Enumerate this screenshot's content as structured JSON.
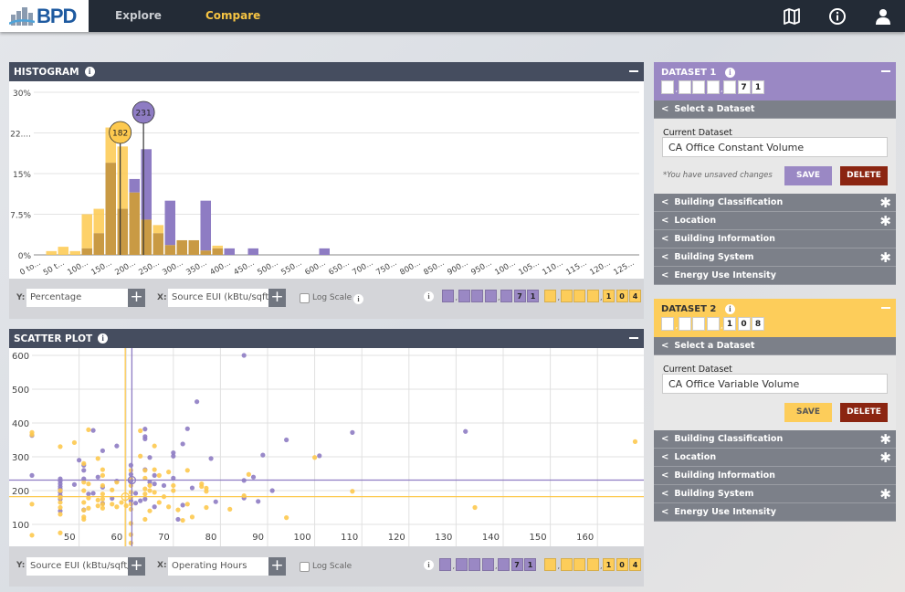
{
  "nav": {
    "logo_text": "BPD",
    "links": [
      {
        "label": "Explore",
        "active": false
      },
      {
        "label": "Compare",
        "active": true
      }
    ],
    "icons": [
      "map-icon",
      "info-icon",
      "user-icon"
    ],
    "colors": {
      "bg": "#232b36",
      "active": "#f6c443",
      "inactive": "#c9ccd1"
    }
  },
  "colors": {
    "dataset1": "#8e7cc3",
    "dataset2": "#fdc94f",
    "overlap": "#c99a44",
    "delete": "#8b2511"
  },
  "histogram": {
    "title": "HISTOGRAM",
    "y_label": "Y:",
    "y_value": "Percentage",
    "x_label": "X:",
    "x_value": "Source EUI (kBtu/sqft/y",
    "log_scale_label": "Log Scale",
    "log_scale_checked": false,
    "counter1": "71",
    "counter2": "104"
  },
  "scatter": {
    "title": "SCATTER PLOT",
    "y_label": "Y:",
    "y_value": "Source EUI (kBtu/sqft/y",
    "x_label": "X:",
    "x_value": "Operating Hours",
    "log_scale_label": "Log Scale",
    "log_scale_checked": false,
    "counter1": "71",
    "counter2": "104"
  },
  "datasets": [
    {
      "title": "DATASET 1",
      "count": "71",
      "color": "#9a88c4",
      "select_label": "Select a Dataset",
      "current_label": "Current Dataset",
      "current_value": "CA Office Constant Volume",
      "unsaved": "*You have unsaved changes",
      "save": "SAVE",
      "delete": "DELETE",
      "save_color": "#9a88c4",
      "sections": [
        {
          "label": "Building Classification",
          "filtered": true
        },
        {
          "label": "Location",
          "filtered": true
        },
        {
          "label": "Building Information",
          "filtered": false
        },
        {
          "label": "Building System",
          "filtered": true
        },
        {
          "label": "Energy Use Intensity",
          "filtered": false
        }
      ]
    },
    {
      "title": "DATASET 2",
      "count": "108",
      "color": "#fdcd5a",
      "select_label": "Select a Dataset",
      "current_label": "Current Dataset",
      "current_value": "CA Office Variable Volume",
      "unsaved": "",
      "save": "SAVE",
      "delete": "DELETE",
      "save_color": "#fdcd5a",
      "sections": [
        {
          "label": "Building Classification",
          "filtered": true
        },
        {
          "label": "Location",
          "filtered": true
        },
        {
          "label": "Building Information",
          "filtered": false
        },
        {
          "label": "Building System",
          "filtered": true
        },
        {
          "label": "Energy Use Intensity",
          "filtered": false
        }
      ]
    }
  ],
  "chart_data": [
    {
      "type": "bar",
      "title": "HISTOGRAM",
      "bin_width": 25,
      "xlim": [
        0,
        1275
      ],
      "ylim": [
        0,
        30
      ],
      "y_ticks": [
        "0%",
        "7.5%",
        "15%",
        "22....",
        "30%"
      ],
      "y_tick_values": [
        0,
        7.5,
        15,
        22.5,
        30
      ],
      "x_tick_labels": [
        "0 to...",
        "50 t...",
        "100...",
        "150...",
        "200...",
        "250...",
        "300...",
        "350...",
        "400...",
        "450...",
        "500...",
        "550...",
        "600...",
        "650...",
        "700...",
        "750...",
        "800...",
        "850...",
        "900...",
        "950...",
        "100...",
        "105...",
        "110...",
        "115...",
        "120...",
        "125..."
      ],
      "x_tick_values": [
        0,
        50,
        100,
        150,
        200,
        250,
        300,
        350,
        400,
        450,
        500,
        550,
        600,
        650,
        700,
        750,
        800,
        850,
        900,
        950,
        1000,
        1050,
        1100,
        1150,
        1200,
        1250
      ],
      "series": [
        {
          "color": "#8e7cc3",
          "mean": 231,
          "values": [
            0,
            0,
            0,
            0,
            1.2,
            4,
            17,
            8.5,
            14,
            19.5,
            4,
            10,
            2.7,
            2.7,
            10,
            1.2,
            1.2,
            0,
            1.2,
            0,
            0,
            0,
            0,
            0,
            1.2
          ]
        },
        {
          "color": "#fdc94f",
          "mean": 182,
          "values": [
            0,
            0.7,
            1.5,
            0.7,
            7.5,
            8.5,
            23.5,
            20,
            11.5,
            6.5,
            5.5,
            1.8,
            2.7,
            2.7,
            0.8,
            1.7,
            0,
            0,
            0,
            0,
            0,
            0,
            0,
            0,
            0
          ]
        }
      ],
      "grid": "horizontal"
    },
    {
      "type": "scatter",
      "title": "SCATTER PLOT",
      "xlim": [
        40,
        170
      ],
      "ylim": [
        38,
        600
      ],
      "x_ticks": [
        50,
        60,
        70,
        80,
        90,
        100,
        110,
        120,
        130,
        140,
        150,
        160
      ],
      "y_ticks": [
        100,
        200,
        300,
        400,
        500,
        600
      ],
      "grid": "both",
      "series": [
        {
          "color": "#8e7cc3",
          "mean_x": 61.2,
          "mean_y": 231,
          "points": [
            [
              40,
              363
            ],
            [
              40,
              245
            ],
            [
              46,
              235
            ],
            [
              46,
              228
            ],
            [
              46,
              220
            ],
            [
              46,
              212
            ],
            [
              46,
              205
            ],
            [
              46,
              195
            ],
            [
              46,
              185
            ],
            [
              46,
              175
            ],
            [
              46,
              140
            ],
            [
              49,
              218
            ],
            [
              50,
              290
            ],
            [
              51,
              275
            ],
            [
              51,
              260
            ],
            [
              51,
              235
            ],
            [
              51,
              143
            ],
            [
              52,
              190
            ],
            [
              53,
              192
            ],
            [
              53,
              378
            ],
            [
              54,
              240
            ],
            [
              55,
              318
            ],
            [
              55,
              210
            ],
            [
              55,
              162
            ],
            [
              57,
              177
            ],
            [
              58,
              332
            ],
            [
              58,
              228
            ],
            [
              61,
              275
            ],
            [
              61,
              248
            ],
            [
              61,
              228
            ],
            [
              61,
              170
            ],
            [
              62,
              192
            ],
            [
              62,
              163
            ],
            [
              63,
              170
            ],
            [
              64,
              382
            ],
            [
              64,
              360
            ],
            [
              64,
              353
            ],
            [
              64,
              262
            ],
            [
              64,
              175
            ],
            [
              65,
              225
            ],
            [
              65,
              298
            ],
            [
              66,
              245
            ],
            [
              66,
              220
            ],
            [
              66,
              152
            ],
            [
              68,
              215
            ],
            [
              70,
              312
            ],
            [
              70,
              302
            ],
            [
              70,
              237
            ],
            [
              71,
              115
            ],
            [
              72,
              338
            ],
            [
              72,
              157
            ],
            [
              73,
              383
            ],
            [
              74,
              208
            ],
            [
              75,
              463
            ],
            [
              78,
              295
            ],
            [
              79,
              167
            ],
            [
              85,
              600
            ],
            [
              85,
              230
            ],
            [
              85,
              178
            ],
            [
              87,
              240
            ],
            [
              88,
              168
            ],
            [
              89,
              305
            ],
            [
              91,
              200
            ],
            [
              94,
              350
            ],
            [
              101,
              303
            ],
            [
              108,
              372
            ],
            [
              132,
              375
            ]
          ]
        },
        {
          "color": "#fdc94f",
          "mean_x": 59.8,
          "mean_y": 182,
          "points": [
            [
              40,
              372
            ],
            [
              40,
              365
            ],
            [
              40,
              160
            ],
            [
              40,
              68
            ],
            [
              46,
              330
            ],
            [
              46,
              200
            ],
            [
              46,
              180
            ],
            [
              46,
              165
            ],
            [
              46,
              150
            ],
            [
              46,
              130
            ],
            [
              46,
              75
            ],
            [
              49,
              342
            ],
            [
              51,
              280
            ],
            [
              51,
              225
            ],
            [
              51,
              200
            ],
            [
              51,
              165
            ],
            [
              51,
              142
            ],
            [
              51,
              122
            ],
            [
              51,
              115
            ],
            [
              52,
              380
            ],
            [
              52,
              220
            ],
            [
              52,
              178
            ],
            [
              52,
              148
            ],
            [
              54,
              295
            ],
            [
              54,
              172
            ],
            [
              54,
              155
            ],
            [
              55,
              262
            ],
            [
              55,
              245
            ],
            [
              55,
              215
            ],
            [
              55,
              190
            ],
            [
              55,
              175
            ],
            [
              55,
              160
            ],
            [
              55,
              148
            ],
            [
              57,
              160
            ],
            [
              57,
              202
            ],
            [
              58,
              225
            ],
            [
              58,
              152
            ],
            [
              59,
              165
            ],
            [
              60,
              155
            ],
            [
              61,
              260
            ],
            [
              61,
              235
            ],
            [
              61,
              215
            ],
            [
              61,
              195
            ],
            [
              61,
              180
            ],
            [
              61,
              160
            ],
            [
              61,
              145
            ],
            [
              61,
              103
            ],
            [
              61,
              70
            ],
            [
              61,
              45
            ],
            [
              63,
              377
            ],
            [
              63,
              302
            ],
            [
              64,
              260
            ],
            [
              64,
              237
            ],
            [
              64,
              205
            ],
            [
              64,
              190
            ],
            [
              64,
              115
            ],
            [
              65,
              140
            ],
            [
              65,
              200
            ],
            [
              65,
              215
            ],
            [
              66,
              332
            ],
            [
              66,
              262
            ],
            [
              66,
              195
            ],
            [
              67,
              165
            ],
            [
              67,
              245
            ],
            [
              68,
              182
            ],
            [
              69,
              255
            ],
            [
              69,
              152
            ],
            [
              70,
              215
            ],
            [
              70,
              200
            ],
            [
              71,
              143
            ],
            [
              72,
              112
            ],
            [
              73,
              260
            ],
            [
              73,
              160
            ],
            [
              74,
              122
            ],
            [
              76,
              220
            ],
            [
              76,
              212
            ],
            [
              77,
              207
            ],
            [
              77,
              150
            ],
            [
              77,
              198
            ],
            [
              82,
              145
            ],
            [
              85,
              185
            ],
            [
              86,
              248
            ],
            [
              94,
              120
            ],
            [
              100,
              298
            ],
            [
              108,
              198
            ],
            [
              134,
              150
            ],
            [
              168,
              345
            ]
          ]
        }
      ]
    }
  ]
}
